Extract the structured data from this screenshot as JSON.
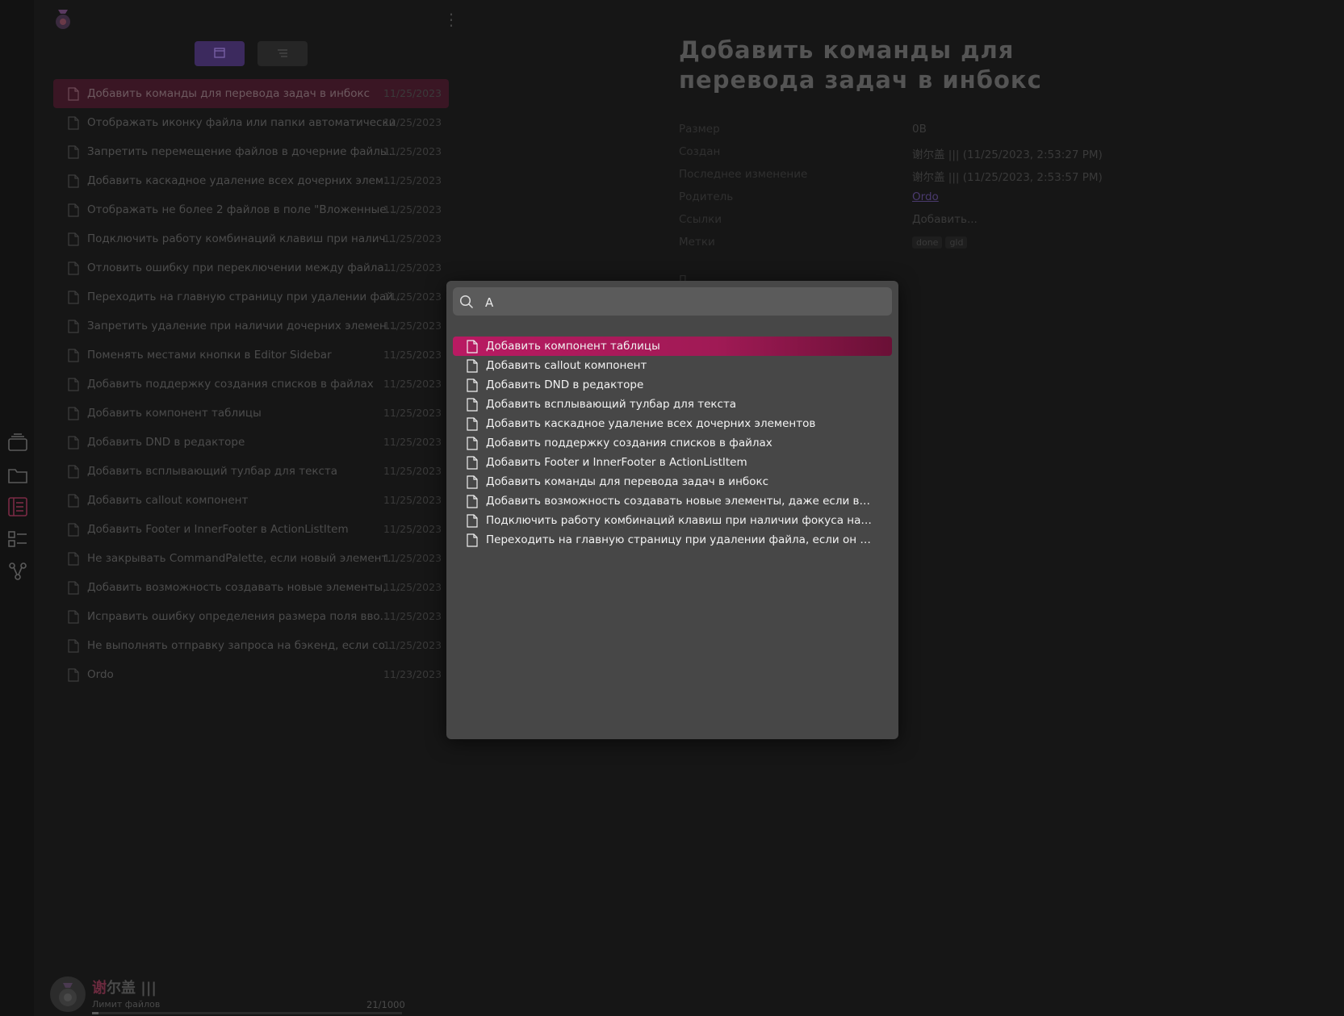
{
  "colors": {
    "accent": "#b91a62",
    "view_active": "#3c2a5e",
    "link": "#4a3a6e"
  },
  "sidebar": {
    "view_buttons": [
      {
        "icon": "calendar-icon",
        "active": true
      },
      {
        "icon": "list-icon",
        "active": false
      }
    ],
    "items": [
      {
        "title": "Добавить команды для перевода задач в инбокс",
        "date": "11/25/2023"
      },
      {
        "title": "Отображать иконку файла или папки автоматически",
        "date": "11/25/2023"
      },
      {
        "title": "Запретить перемещение файлов в дочерние файлы...",
        "date": "11/25/2023"
      },
      {
        "title": "Добавить каскадное удаление всех дочерних элем...",
        "date": "11/25/2023"
      },
      {
        "title": "Отображать не более 2 файлов в поле \"Вложенные...",
        "date": "11/25/2023"
      },
      {
        "title": "Подключить работу комбинаций клавиш при налич...",
        "date": "11/25/2023"
      },
      {
        "title": "Отловить ошибку при переключении между файла...",
        "date": "11/25/2023"
      },
      {
        "title": "Переходить на главную страницу при удалении фай...",
        "date": "11/25/2023"
      },
      {
        "title": "Запретить удаление при наличии дочерних элемен...",
        "date": "11/25/2023"
      },
      {
        "title": "Поменять местами кнопки в Editor Sidebar",
        "date": "11/25/2023"
      },
      {
        "title": "Добавить поддержку создания списков в файлах",
        "date": "11/25/2023"
      },
      {
        "title": "Добавить компонент таблицы",
        "date": "11/25/2023"
      },
      {
        "title": "Добавить DND в редакторе",
        "date": "11/25/2023"
      },
      {
        "title": "Добавить всплывающий тулбар для текста",
        "date": "11/25/2023"
      },
      {
        "title": "Добавить callout компонент",
        "date": "11/25/2023"
      },
      {
        "title": "Добавить Footer и InnerFooter в ActionListItem",
        "date": "11/25/2023"
      },
      {
        "title": "Не закрывать CommandPalette, если новый элемент...",
        "date": "11/25/2023"
      },
      {
        "title": "Добавить возможность создавать новые элементы, ...",
        "date": "11/25/2023"
      },
      {
        "title": "Исправить ошибку определения размера поля вво...",
        "date": "11/25/2023"
      },
      {
        "title": "Не выполнять отправку запроса на бэкенд, если со...",
        "date": "11/25/2023"
      },
      {
        "title": "Ordo",
        "date": "11/23/2023"
      }
    ],
    "user": {
      "name_highlight": "谢",
      "name_rest": "尔盖 |||",
      "limit_label": "Лимит файлов",
      "count": "21/1000",
      "usage_fraction": 0.021
    }
  },
  "detail": {
    "title": "Добавить команды для перевода задач в инбокс",
    "props": [
      {
        "key": "Размер",
        "value": "0B"
      },
      {
        "key": "Создан",
        "value": "谢尔盖 ||| (11/25/2023, 2:53:27 PM)"
      },
      {
        "key": "Последнее изменение",
        "value": "谢尔盖 ||| (11/25/2023, 2:53:57 PM)"
      },
      {
        "key": "Родитель",
        "value": "Ordo"
      },
      {
        "key": "Ссылки",
        "value": "Добавить..."
      }
    ],
    "tags_label": "Метки",
    "tags": [
      "done",
      "gld"
    ],
    "peek": "П"
  },
  "palette": {
    "search_value": "А",
    "results": [
      "Добавить компонент таблицы",
      "Добавить callout компонент",
      "Добавить DND в редакторе",
      "Добавить всплывающий тулбар для текста",
      "Добавить каскадное удаление всех дочерних элементов",
      "Добавить поддержку создания списков в файлах",
      "Добавить Footer и InnerFooter в ActionListItem",
      "Добавить команды для перевода задач в инбокс",
      "Добавить возможность создавать новые элементы, даже если в списк...",
      "Подключить работу комбинаций клавиш при наличии фокуса на редак...",
      "Переходить на главную страницу при удалении файла, если он был от..."
    ]
  }
}
